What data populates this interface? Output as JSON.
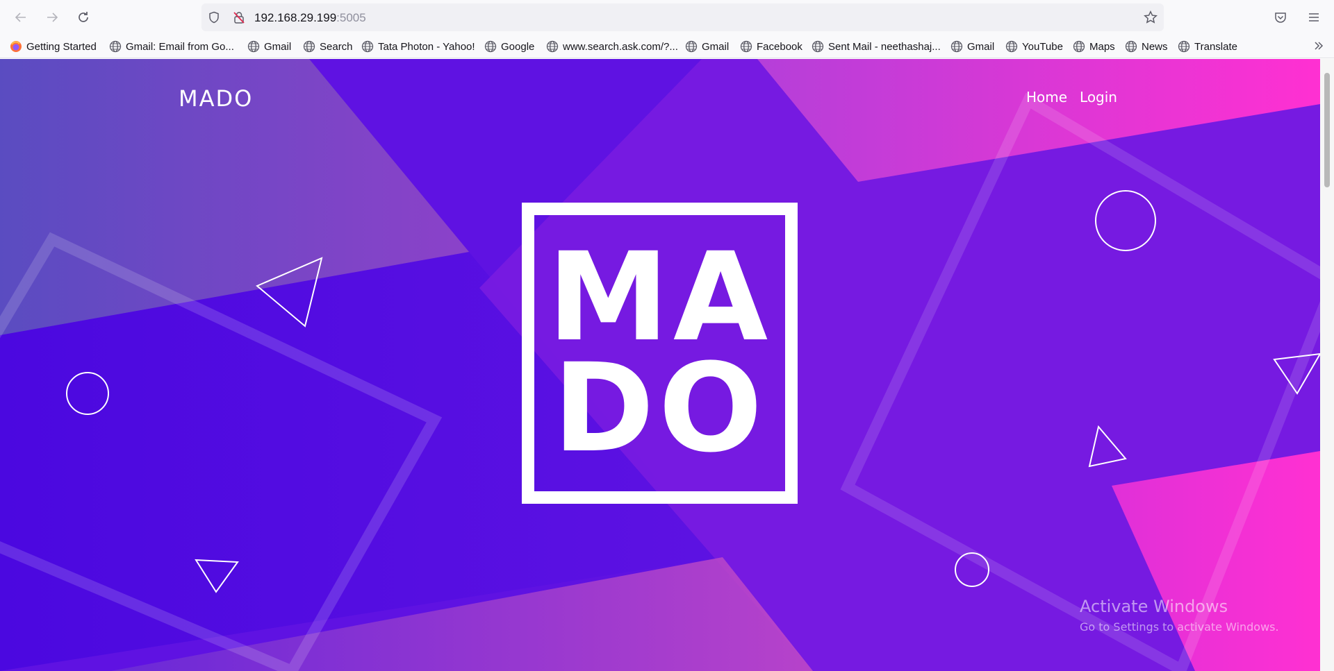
{
  "browser": {
    "url_host": "192.168.29.199",
    "url_port": ":5005",
    "bookmarks": [
      {
        "label": "Getting Started",
        "icon": "firefox-icon"
      },
      {
        "label": "Gmail: Email from Go...",
        "icon": "globe-icon"
      },
      {
        "label": "Gmail",
        "icon": "globe-icon"
      },
      {
        "label": "Search",
        "icon": "globe-icon"
      },
      {
        "label": "Tata Photon - Yahoo!",
        "icon": "globe-icon"
      },
      {
        "label": "Google",
        "icon": "globe-icon"
      },
      {
        "label": "www.search.ask.com/?...",
        "icon": "globe-icon"
      },
      {
        "label": "Gmail",
        "icon": "globe-icon"
      },
      {
        "label": "Facebook",
        "icon": "globe-icon"
      },
      {
        "label": "Sent Mail - neethashaj...",
        "icon": "globe-icon"
      },
      {
        "label": "Gmail",
        "icon": "globe-icon"
      },
      {
        "label": "YouTube",
        "icon": "globe-icon"
      },
      {
        "label": "Maps",
        "icon": "globe-icon"
      },
      {
        "label": "News",
        "icon": "globe-icon"
      },
      {
        "label": "Translate",
        "icon": "globe-icon"
      }
    ]
  },
  "site": {
    "brand": "MADO",
    "nav": {
      "home": "Home",
      "login": "Login"
    },
    "logo": {
      "line1": "MA",
      "line2": "DO"
    }
  },
  "watermark": {
    "title": "Activate Windows",
    "subtitle": "Go to Settings to activate Windows."
  },
  "colors": {
    "base_purple": "#5f12e2",
    "pink": "#ff2fd0",
    "white": "#ffffff"
  }
}
